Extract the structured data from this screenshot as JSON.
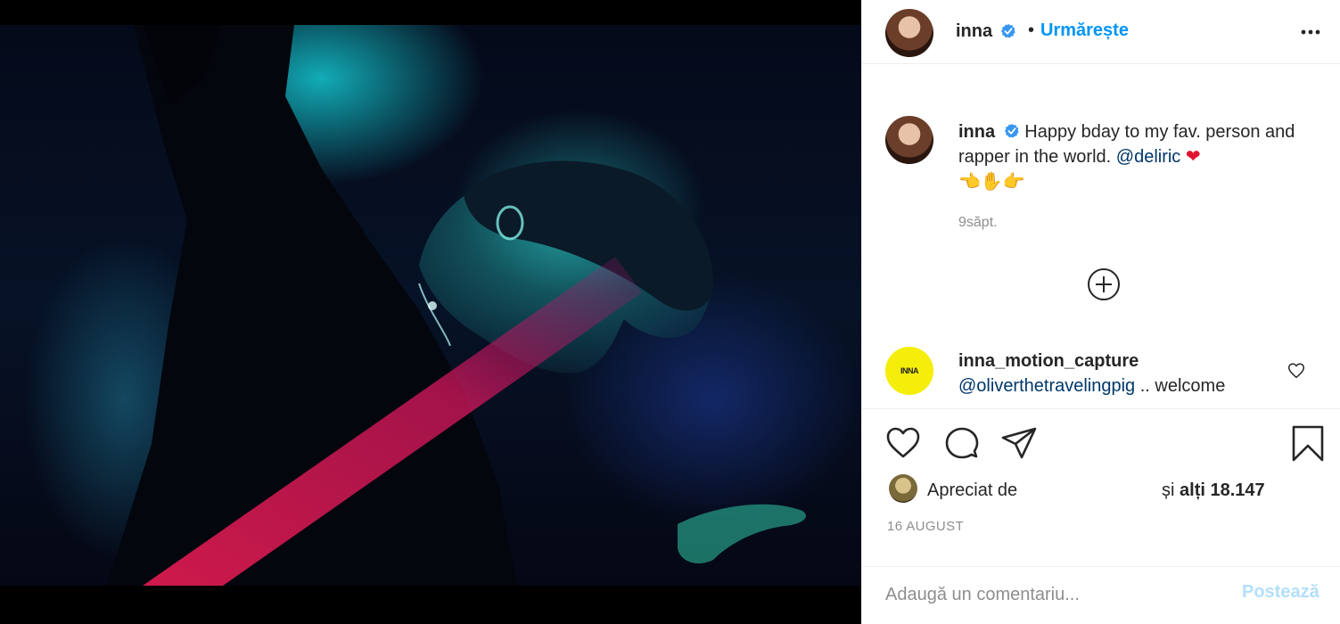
{
  "post": {
    "username": "inna",
    "follow_separator": "•",
    "follow_label": "Urmărește",
    "caption_text": "Happy bday to my fav. person and rapper in the world.",
    "caption_mention": "@deliric",
    "caption_emojis": "👈✋👉",
    "heart_emoji": "❤",
    "time_ago": "9săpt.",
    "likes_prefix": "Apreciat de",
    "likes_suffix_pre": "și",
    "likes_suffix_bold": "alți 18.147",
    "date": "16 AUGUST"
  },
  "comment": {
    "username": "inna_motion_capture",
    "mention": "@oliverthetravelingpig",
    "text": " .. welcome",
    "avatar_text": "INNA"
  },
  "composer": {
    "placeholder": "Adaugă un comentariu...",
    "post_label": "Postează"
  },
  "icons": {
    "more": "more-options-icon",
    "verified": "verified-badge-icon",
    "load_more": "plus-circle-icon",
    "like": "heart-icon",
    "comment": "comment-bubble-icon",
    "share": "paper-plane-icon",
    "save": "bookmark-icon"
  },
  "colors": {
    "accent": "#0095f6",
    "mention": "#00376b",
    "post_disabled": "#b2dffc"
  }
}
